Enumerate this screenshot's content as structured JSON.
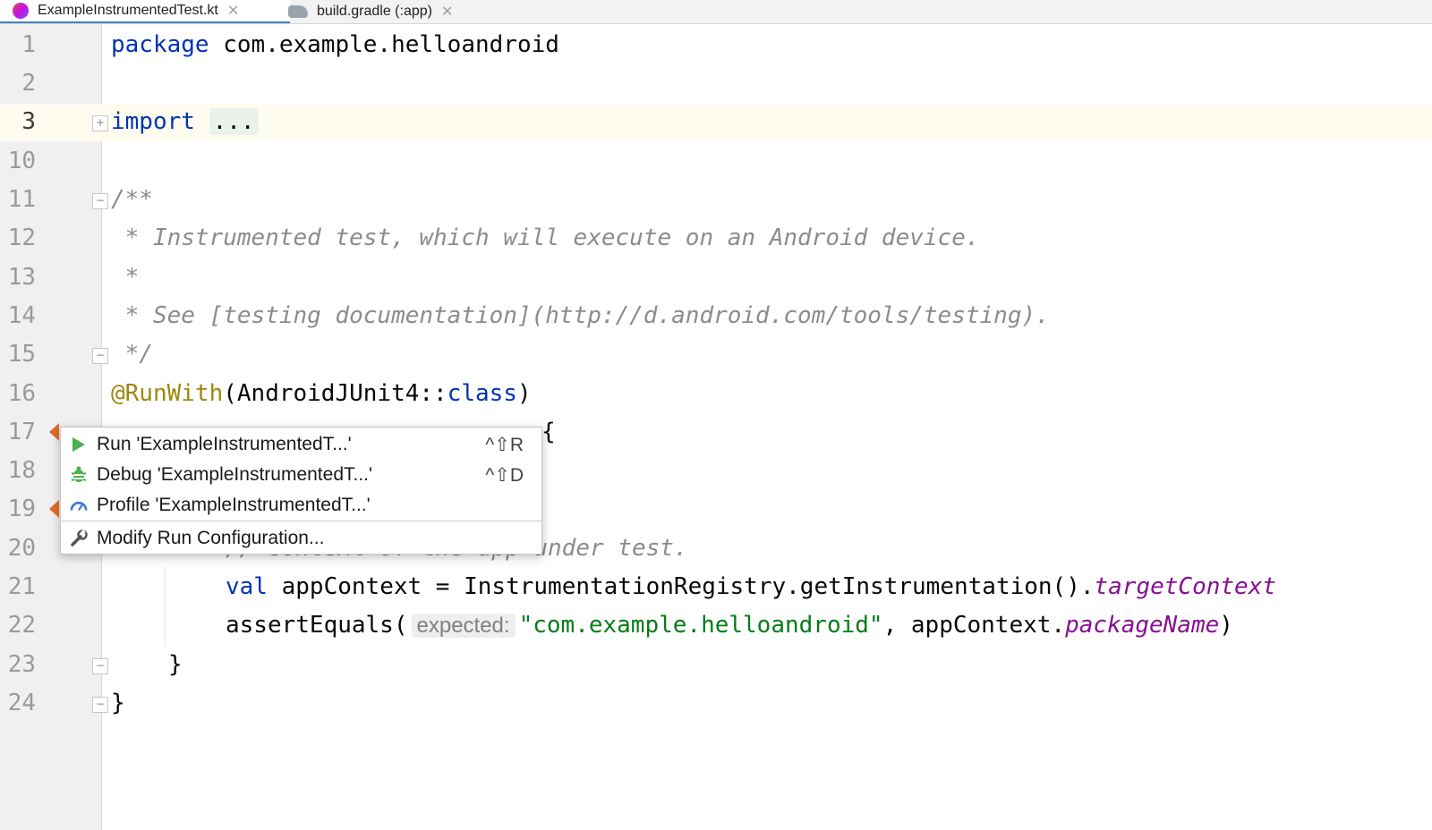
{
  "tabs": [
    {
      "label": "ExampleInstrumentedTest.kt",
      "active": true
    },
    {
      "label": "build.gradle (:app)",
      "active": false
    }
  ],
  "lines": {
    "l1": {
      "num": "1",
      "kw": "package",
      "rest": " com.example.helloandroid"
    },
    "l2": {
      "num": "2"
    },
    "l3": {
      "num": "3",
      "kw": "import",
      "folded": "..."
    },
    "l10": {
      "num": "10"
    },
    "l11": {
      "num": "11",
      "text": "/**"
    },
    "l12": {
      "num": "12",
      "text": " * Instrumented test, which will execute on an Android device."
    },
    "l13": {
      "num": "13",
      "text": " *"
    },
    "l14": {
      "num": "14",
      "text": " * See [testing documentation](http://d.android.com/tools/testing)."
    },
    "l15": {
      "num": "15",
      "text": " */"
    },
    "l16": {
      "num": "16",
      "ann": "@RunWith",
      "a": "(AndroidJUnit4::",
      "kw": "class",
      "b": ")"
    },
    "l17": {
      "num": "17",
      "text": "{"
    },
    "l18": {
      "num": "18"
    },
    "l19": {
      "num": "19"
    },
    "l20": {
      "num": "20",
      "text": "// Context of the app under test."
    },
    "l21": {
      "num": "21",
      "kw": "val",
      "a": " appContext = InstrumentationRegistry.getInstrumentation().",
      "prop": "targetContext"
    },
    "l22": {
      "num": "22",
      "a": "assertEquals(",
      "hint": "expected:",
      "str": "\"com.example.helloandroid\"",
      "b": ", appContext.",
      "prop": "packageName",
      "c": ")"
    },
    "l23": {
      "num": "23",
      "text": "}"
    },
    "l24": {
      "num": "24",
      "text": "}"
    }
  },
  "popup": {
    "items": [
      {
        "label": "Run 'ExampleInstrumentedT...'",
        "shortcut": "^⇧R",
        "icon": "run-icon"
      },
      {
        "label": "Debug 'ExampleInstrumentedT...'",
        "shortcut": "^⇧D",
        "icon": "debug-icon"
      },
      {
        "label": "Profile 'ExampleInstrumentedT...'",
        "icon": "profile-icon"
      },
      {
        "label": "Modify Run Configuration...",
        "icon": "wrench-icon"
      }
    ]
  },
  "colors": {
    "keyword": "#0033b3",
    "comment": "#8c8c8c",
    "annotation": "#9e880d",
    "string": "#067d17",
    "property": "#871094",
    "run_marker": "#e06c2b",
    "run_icon": "#4caf50"
  }
}
